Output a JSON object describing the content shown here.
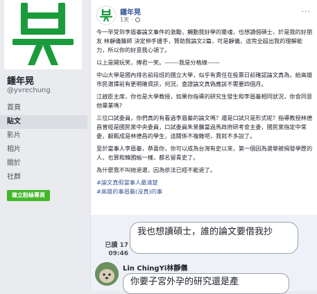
{
  "sidebar": {
    "page_name": "鍾年晃",
    "handle": "@yvrechung",
    "nav": [
      {
        "label": "首頁"
      },
      {
        "label": "貼文"
      },
      {
        "label": "影片"
      },
      {
        "label": "相片"
      },
      {
        "label": "關於"
      },
      {
        "label": "社群"
      }
    ],
    "active_index": 1,
    "create_button": "建立粉絲專頁"
  },
  "post": {
    "author": "鍾年晃",
    "time": "1天",
    "privacy_icon": "globe-icon",
    "more_icon": "more-dots-icon",
    "paragraphs": [
      "今一早受到李眉蓁論文事件的激勵，觸動我好學的靈魂，也想讀個碩士，於是我的好朋友 林靜儀醫師 決定伸手援手，贊助我論文2篇，可是靜儀，這完全超出我的理解能力，所以你的好意我心領了。",
      "以上是開玩笑，搏君一笑。-------我是分格線------",
      "中山大學是國內排名前段班的國立大學，似乎有責任在投票日前確認論文真為，給高雄市民選擇前有更明確資訊，何況，查證論文真偽應該不需要四個月。",
      "江啟臣主席，你也是大學教授，如果你指導的研究生發生和李眉蓁相同狀況，你會同意他畢業嗎?",
      "三位口試委員，你們真的有看過李眉蓁的論文嗎？還是口試只是形式呢？指導教授林德昌曾經是國民黨中央委員，口試委員朱景鵬當過馬政府研考會主委，國民黨指定中常委，靓甄成是林德昌的學生，這關係不複雜吧，我就不多說了。",
      "至於當事人李眉蓁，恭喜你，你可以成為台灣有史以來，第一個因為選舉被揭發學歷的人，也算和韓國瑜一樣，都名留青史了。",
      "為什麼我不叫她退選，因為依法已經不能退了。"
    ],
    "hashtags": [
      "#論文真假當事人最清楚",
      "#高雄的事眉蓁(沒真)的事"
    ]
  },
  "chat": {
    "my_message": "我也想讀碩士，誰的論文要借我抄",
    "read_label": "已讀 17",
    "read_time": "09:46",
    "sender_name": "Lin ChingYi林靜儀",
    "their_message": "你要子宮外孕的研究還是產"
  },
  "colors": {
    "brand_green": "#1a9b3c",
    "link_blue": "#385898",
    "button_green": "#42b72a"
  }
}
